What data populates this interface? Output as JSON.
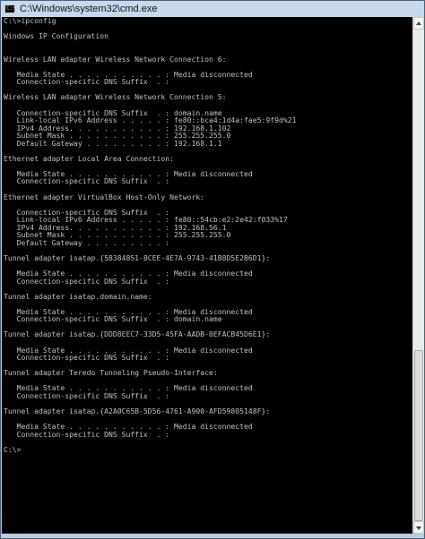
{
  "window": {
    "title": "C:\\Windows\\system32\\cmd.exe",
    "icon_text": "C:\\"
  },
  "console": {
    "lines": [
      "C:\\>ipconfig",
      "",
      "Windows IP Configuration",
      "",
      "",
      "Wireless LAN adapter Wireless Network Connection 6:",
      "",
      "   Media State . . . . . . . . . . . : Media disconnected",
      "   Connection-specific DNS Suffix  . :",
      "",
      "Wireless LAN adapter Wireless Network Connection 5:",
      "",
      "   Connection-specific DNS Suffix  . : domain.name",
      "   Link-local IPv6 Address . . . . . : fe80::bca4:1d4a:fae5:9f9d%21",
      "   IPv4 Address. . . . . . . . . . . : 192.168.1.102",
      "   Subnet Mask . . . . . . . . . . . : 255.255.255.0",
      "   Default Gateway . . . . . . . . . : 192.168.1.1",
      "",
      "Ethernet adapter Local Area Connection:",
      "",
      "   Media State . . . . . . . . . . . : Media disconnected",
      "   Connection-specific DNS Suffix  . :",
      "",
      "Ethernet adapter VirtualBox Host-Only Network:",
      "",
      "   Connection-specific DNS Suffix  . :",
      "   Link-local IPv6 Address . . . . . : fe80::54cb:e2:2e42:f033%17",
      "   IPv4 Address. . . . . . . . . . . : 192.168.56.1",
      "   Subnet Mask . . . . . . . . . . . : 255.255.255.0",
      "   Default Gateway . . . . . . . . . :",
      "",
      "Tunnel adapter isatap.{58384851-8CEE-4E7A-9743-41B8D5E2B6D1}:",
      "",
      "   Media State . . . . . . . . . . . : Media disconnected",
      "   Connection-specific DNS Suffix  . :",
      "",
      "Tunnel adapter isatap.domain.name:",
      "",
      "   Media State . . . . . . . . . . . : Media disconnected",
      "   Connection-specific DNS Suffix  . : domain.name",
      "",
      "Tunnel adapter isatap.{DDD8EEC7-33D5-45FA-AADB-0EFACB45D6E1}:",
      "",
      "   Media State . . . . . . . . . . . : Media disconnected",
      "   Connection-specific DNS Suffix  . :",
      "",
      "Tunnel adapter Teredo Tunneling Pseudo-Interface:",
      "",
      "   Media State . . . . . . . . . . . : Media disconnected",
      "   Connection-specific DNS Suffix  . :",
      "",
      "Tunnel adapter isatap.{A2A0C65B-5D56-4761-A900-AFD59805148F}:",
      "",
      "   Media State . . . . . . . . . . . : Media disconnected",
      "   Connection-specific DNS Suffix  . :",
      "",
      "C:\\>"
    ]
  },
  "colors": {
    "console_background": "#000000",
    "console_text": "#c0c0c0",
    "frame": "#b9cfe4"
  },
  "icons": {
    "app": "cmd-icon",
    "scroll_up": "scroll-up-arrow-icon",
    "scroll_down": "scroll-down-arrow-icon"
  }
}
